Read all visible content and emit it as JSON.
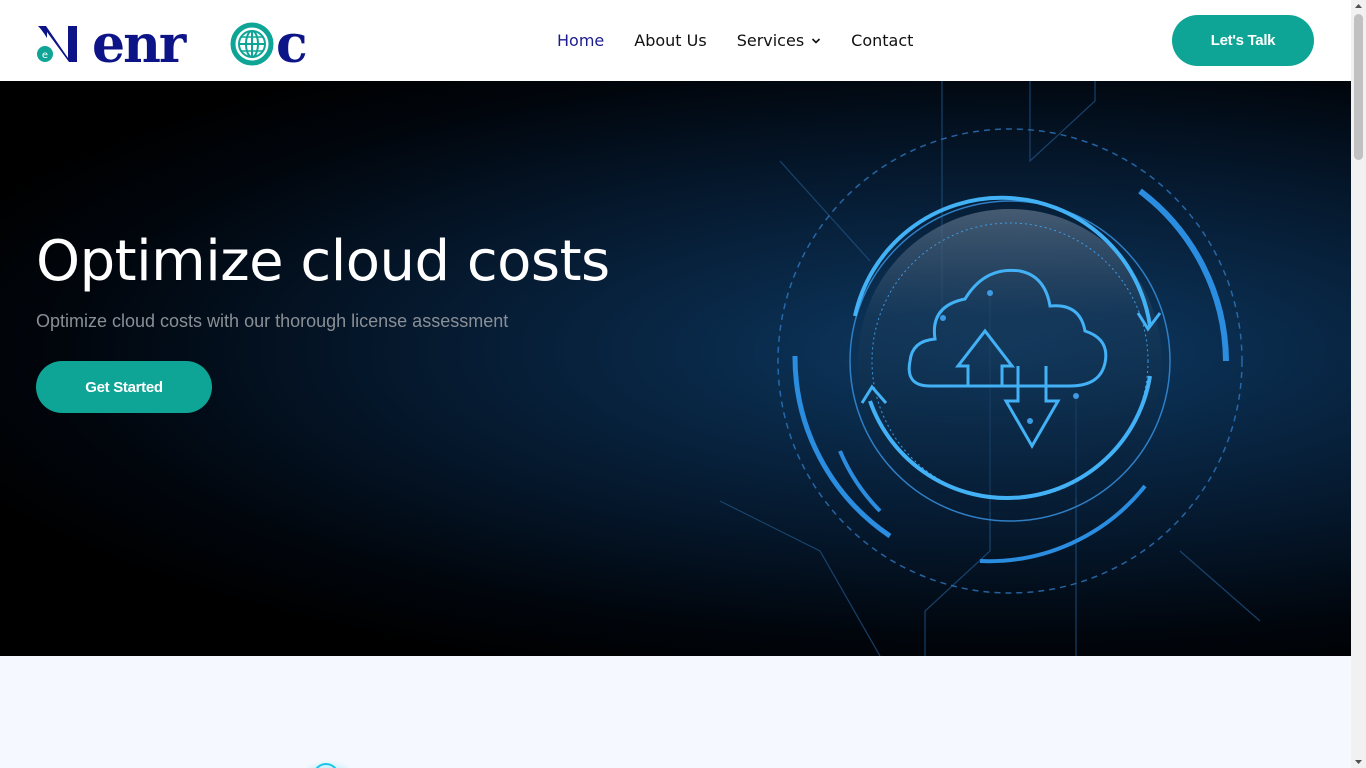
{
  "brand": {
    "logo_text": "enroc",
    "logo_initial": "e"
  },
  "nav": {
    "items": [
      {
        "label": "Home"
      },
      {
        "label": "About Us"
      },
      {
        "label": "Services"
      },
      {
        "label": "Contact"
      }
    ]
  },
  "header": {
    "cta_label": "Let's Talk"
  },
  "hero": {
    "title": "Optimize cloud costs",
    "subtitle": "Optimize cloud costs with our thorough license assessment",
    "cta_label": "Get Started"
  },
  "colors": {
    "accent": "#0fa596",
    "brand_navy": "#1c1c8c",
    "hero_bg": "#000000",
    "section_bg": "#f5f8fe"
  },
  "icons": [
    "chevron-down-icon",
    "cloud-sync-icon",
    "globe-icon"
  ]
}
